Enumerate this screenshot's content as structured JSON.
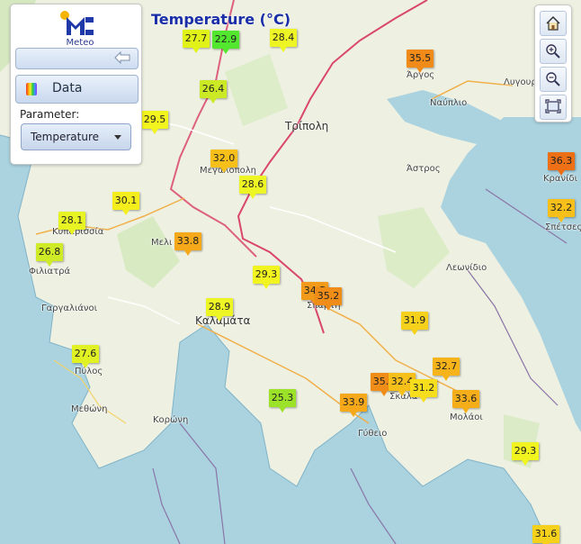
{
  "title": "Temperature (°C)",
  "panel": {
    "logo_text": "Meteo",
    "data_button_label": "Data",
    "parameter_label": "Parameter:",
    "parameter_value": "Temperature"
  },
  "toolbar": {
    "icons": [
      "home-icon",
      "zoom-in-icon",
      "zoom-out-icon",
      "extent-icon"
    ]
  },
  "places": [
    "Τρίπολη",
    "Άργος",
    "Ναύπλιο",
    "Λυγουριό",
    "Άστρος",
    "Κρανίδι",
    "Σπέτσες",
    "Μεγαλόπολη",
    "Κυπαρισσία",
    "Μελι",
    "Φιλιατρά",
    "Γαργαλιάνοι",
    "Καλαμάτα",
    "Σπάρτη",
    "Λεωνίδιο",
    "Πύλος",
    "Μεθώνη",
    "Κορώνη",
    "Σκάλα",
    "Μολάοι",
    "Γύθειο"
  ],
  "markers": [
    {
      "value": "27.7",
      "color": "#e1f219"
    },
    {
      "value": "22.9",
      "color": "#52e62e"
    },
    {
      "value": "28.4",
      "color": "#eef524"
    },
    {
      "value": "35.5",
      "color": "#f08a18"
    },
    {
      "value": "26.4",
      "color": "#cbea25"
    },
    {
      "value": "29.5",
      "color": "#f3f31e"
    },
    {
      "value": "32.0",
      "color": "#f7bf1a"
    },
    {
      "value": "28.6",
      "color": "#eef524"
    },
    {
      "value": "30.1",
      "color": "#f4ee1d"
    },
    {
      "value": "28.1",
      "color": "#e7f323"
    },
    {
      "value": "26.8",
      "color": "#cfea26"
    },
    {
      "value": "33.8",
      "color": "#f5a81a"
    },
    {
      "value": "29.3",
      "color": "#f1f41f"
    },
    {
      "value": "34.5",
      "color": "#f29a19"
    },
    {
      "value": "35.2",
      "color": "#f08c18"
    },
    {
      "value": "31.9",
      "color": "#f6d11b"
    },
    {
      "value": "28.9",
      "color": "#eef524"
    },
    {
      "value": "27.6",
      "color": "#e0f223"
    },
    {
      "value": "25.3",
      "color": "#9be229"
    },
    {
      "value": "33.9",
      "color": "#f5a81a"
    },
    {
      "value": "35.1",
      "color": "#f08c18"
    },
    {
      "value": "32.4",
      "color": "#f7bf1a"
    },
    {
      "value": "31.2",
      "color": "#f6de1c"
    },
    {
      "value": "32.7",
      "color": "#f6b41a"
    },
    {
      "value": "33.6",
      "color": "#f5ae1a"
    },
    {
      "value": "29.3",
      "color": "#f1f41f"
    },
    {
      "value": "36.3",
      "color": "#ed7017"
    },
    {
      "value": "32.2",
      "color": "#f7bf1a"
    },
    {
      "value": "31.6",
      "color": "#f6d11b"
    }
  ]
}
